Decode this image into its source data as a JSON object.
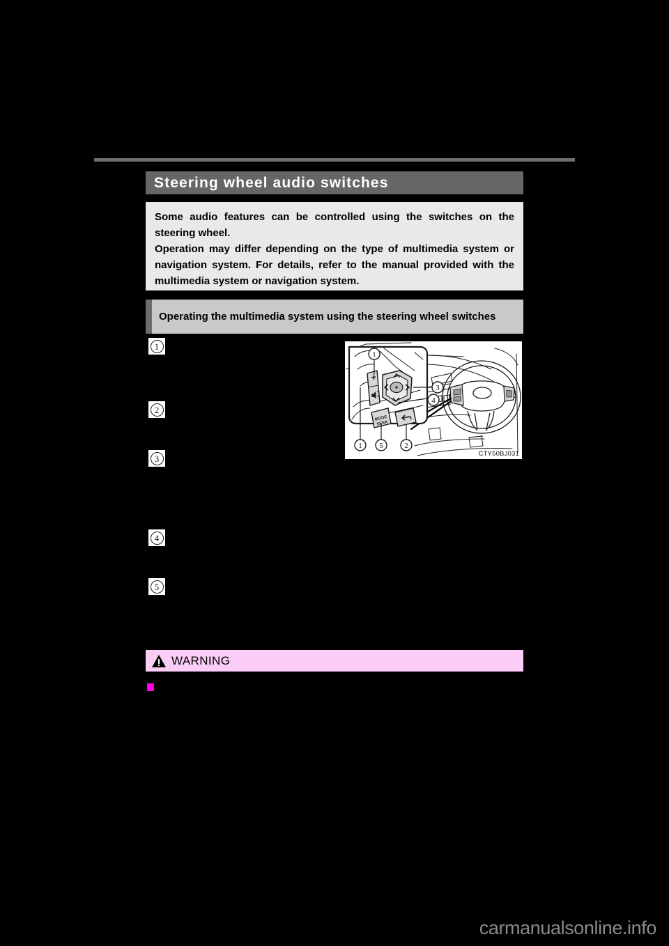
{
  "page": {
    "background_color": "#000000",
    "watermark": "carmanualsonline.info"
  },
  "section": {
    "title": "Steering wheel audio switches",
    "title_bar_color": "#666666"
  },
  "intro": {
    "background_color": "#e9e9e9",
    "paragraph_1": "Some audio features can be controlled using the switches on the steering wheel.",
    "paragraph_2": "Operation may differ depending on the type of multimedia system or navigation system. For details, refer to the manual provided with the multimedia system or navigation system."
  },
  "subsection": {
    "title": "Operating the multimedia system using the steering wheel switches",
    "bar_color": "#c9c9c9",
    "accent_color": "#6e6e6e"
  },
  "callouts": [
    {
      "number": "1"
    },
    {
      "number": "2"
    },
    {
      "number": "3"
    },
    {
      "number": "4"
    },
    {
      "number": "5"
    }
  ],
  "figure": {
    "code": "CTY50BJ031",
    "switch_labels": {
      "mode_seek": "MODE\nSEEK",
      "volume_up": "+",
      "volume_mute": "mute",
      "back": "back-arrow"
    },
    "figure_callouts": [
      "1",
      "3",
      "4",
      "1",
      "5",
      "2"
    ]
  },
  "warning": {
    "label": "WARNING",
    "background_color": "#fbcdf6",
    "icon": "warning-triangle-icon"
  },
  "bullet": {
    "color": "#ff00e8"
  }
}
